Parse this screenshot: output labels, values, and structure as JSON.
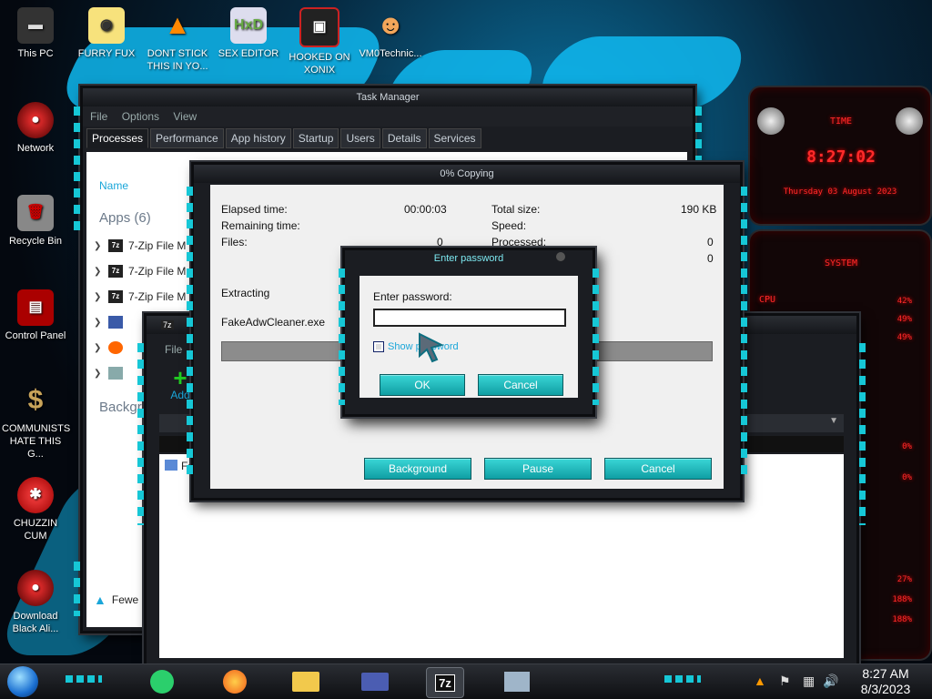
{
  "desktop": {
    "icons": [
      {
        "label": "This PC"
      },
      {
        "label": "FURRY FUX"
      },
      {
        "label": "DONT STICK THIS IN YO..."
      },
      {
        "label": "SEX EDITOR"
      },
      {
        "label": "HOOKED ON XONIX"
      },
      {
        "label": "VM0Technic..."
      },
      {
        "label": "Network"
      },
      {
        "label": "Recycle Bin"
      },
      {
        "label": "Control Panel"
      },
      {
        "label": "COMMUNISTS HATE THIS G..."
      },
      {
        "label": "CHUZZIN CUM"
      },
      {
        "label": "Download Black Ali..."
      }
    ]
  },
  "task_manager": {
    "title": "Task Manager",
    "menu": [
      "File",
      "Options",
      "View"
    ],
    "tabs": [
      "Processes",
      "Performance",
      "App history",
      "Startup",
      "Users",
      "Details",
      "Services"
    ],
    "column_name": "Name",
    "apps_header": "Apps (6)",
    "apps": [
      "7-Zip File M",
      "7-Zip File M",
      "7-Zip File M"
    ],
    "background_header": "Backgr",
    "fewer_details": "Fewe"
  },
  "zip_manager": {
    "app_icon": "7z",
    "menu_first": "File",
    "add_label": "Add",
    "file_row": "Fake"
  },
  "copy_dialog": {
    "title": "0% Copying",
    "elapsed_label": "Elapsed time:",
    "elapsed_value": "00:00:03",
    "remaining_label": "Remaining time:",
    "files_label": "Files:",
    "files_value": "0",
    "total_size_label": "Total size:",
    "total_size_value": "190 KB",
    "speed_label": "Speed:",
    "processed_label": "Processed:",
    "processed_value": "0",
    "extra_value": "0",
    "extracting_label": "Extracting",
    "file_name": "FakeAdwCleaner.exe",
    "buttons": {
      "background": "Background",
      "pause": "Pause",
      "cancel": "Cancel"
    },
    "progress": 0
  },
  "password_dialog": {
    "title": "Enter password",
    "prompt": "Enter password:",
    "password_value": "",
    "show_password_label": "Show password",
    "show_password_checked": false,
    "ok": "OK",
    "cancel": "Cancel"
  },
  "gadget": {
    "time_title": "TIME",
    "clock": "8:27:02",
    "date": "Thursday 03 August 2023",
    "system_title": "SYSTEM",
    "cpu_label": "CPU",
    "readings": [
      "42%",
      "49%",
      "49%",
      "0%",
      "0%",
      "27%",
      "188%",
      "188%"
    ]
  },
  "taskbar": {
    "time": "8:27 AM",
    "date": "8/3/2023",
    "zip_label": "7z"
  },
  "colors": {
    "accent": "#16c7d6",
    "button": "#18b4b8",
    "gadget_red": "#ff2a2a"
  }
}
